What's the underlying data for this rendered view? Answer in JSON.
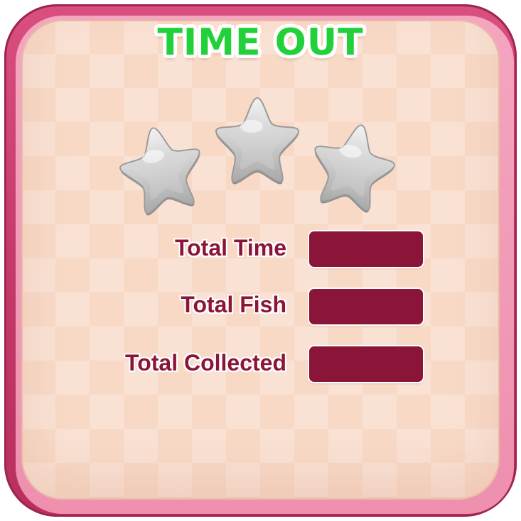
{
  "title": "TIME OUT",
  "stars": {
    "earned": 0,
    "total": 3,
    "icon": "star-icon",
    "color": "#c8c8c8"
  },
  "stats": [
    {
      "label": "Total Time",
      "value": ""
    },
    {
      "label": "Total Fish",
      "value": ""
    },
    {
      "label": "Total Collected",
      "value": ""
    }
  ],
  "colors": {
    "frame": "#c43a6a",
    "panel": "#f7d9c6",
    "title": "#22d13a",
    "label": "#8a1538",
    "value_box": "#8a1538"
  }
}
